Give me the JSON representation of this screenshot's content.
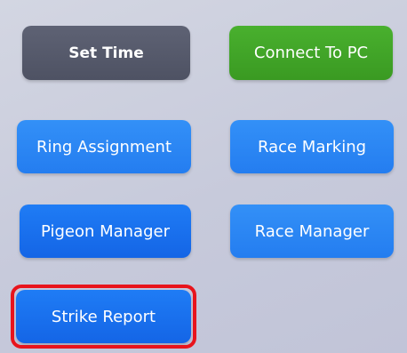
{
  "buttons": {
    "set_time": "Set Time",
    "connect_to_pc": "Connect To PC",
    "ring_assignment": "Ring Assignment",
    "race_marking": "Race Marking",
    "pigeon_manager": "Pigeon Manager",
    "race_manager": "Race Manager",
    "strike_report": "Strike Report"
  },
  "colors": {
    "background": "#c9ccd9",
    "dark_button": "#565a6b",
    "green_button": "#3fa426",
    "blue_button": "#1a70ee",
    "highlight": "#e8141c"
  }
}
